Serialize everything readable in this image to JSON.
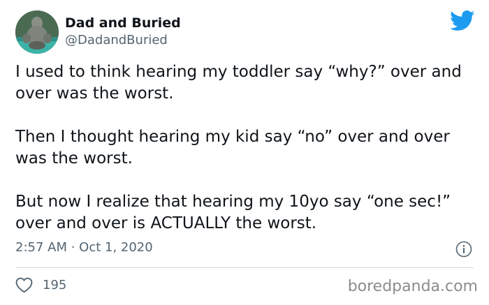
{
  "author": {
    "display_name": "Dad and Buried",
    "handle": "@DadandBuried"
  },
  "icons": {
    "avatar": "avatar-photo",
    "brand": "twitter-bird-icon",
    "info": "info-icon",
    "like": "heart-outline-icon"
  },
  "colors": {
    "brand": "#1d9bf0",
    "text": "#0f1419",
    "muted": "#536471",
    "divider": "#cfd9de"
  },
  "tweet": {
    "paragraphs": [
      "I used to think hearing my toddler say “why?” over and over was the worst.",
      "Then I thought hearing my kid say “no” over and over was the worst.",
      "But now I realize that hearing my 10yo say “one sec!” over and over is ACTUALLY the worst."
    ],
    "timestamp": "2:57 AM · Oct 1, 2020",
    "like_count": "195"
  },
  "watermark": "boredpanda.com"
}
